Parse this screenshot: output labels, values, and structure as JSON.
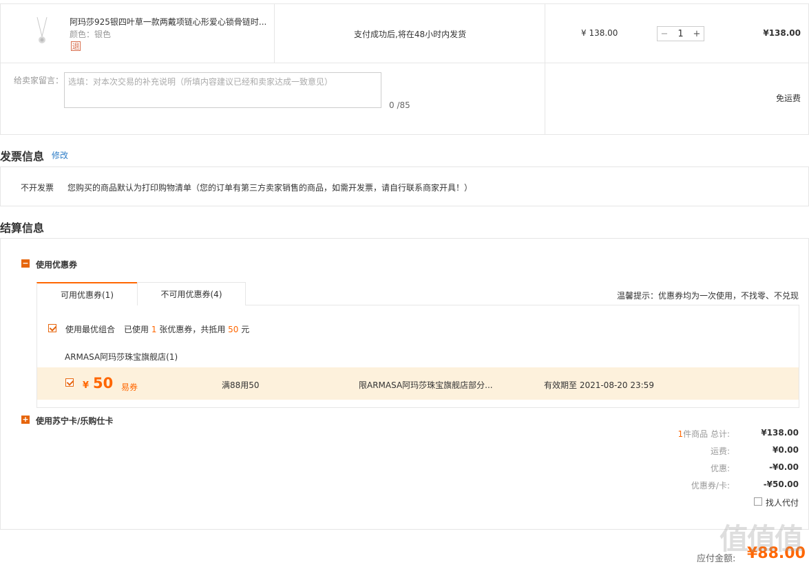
{
  "product": {
    "title": "阿玛莎925银四叶草一款两戴项链心形爱心锁骨链时...",
    "color_label": "颜色：银色",
    "badge": "退",
    "shipping_note": "支付成功后,将在48小时内发货",
    "unit_price": "¥ 138.00",
    "qty_minus": "−",
    "qty_value": "1",
    "qty_plus": "+",
    "subtotal": "¥138.00"
  },
  "remark": {
    "label": "给卖家留言：",
    "placeholder": "选填：对本次交易的补充说明（所填内容建议已经和卖家达成一致意见）",
    "counter": "0 /85",
    "shipping_fee": "免运费"
  },
  "invoice": {
    "title": "发票信息",
    "edit": "修改",
    "type": "不开发票",
    "note": "您购买的商品默认为打印购物清单（您的订单有第三方卖家销售的商品，如需开发票，请自行联系商家开具！）"
  },
  "settlement": {
    "title": "结算信息",
    "coupon_toggle_icon": "−",
    "coupon_section": "使用优惠券",
    "tabs": [
      {
        "label": "可用优惠券(1)"
      },
      {
        "label": "不可用优惠券(4)"
      }
    ],
    "tip": "温馨提示：优惠券均为一次使用，不找零、不兑现",
    "best_combo_label": "使用最优组合",
    "used_prefix": "已使用",
    "used_count": "1",
    "used_middle": "张优惠券，共抵用",
    "used_amount": "50",
    "used_suffix": "元",
    "store_name": "ARMASA阿玛莎珠宝旗舰店(1)",
    "coupon": {
      "currency": "¥",
      "amount": "50",
      "tag": "易券",
      "condition": "满88用50",
      "scope": "限ARMASA阿玛莎珠宝旗舰店部分...",
      "expiry": "有效期至 2021-08-20 23:59"
    },
    "card_toggle_icon": "+",
    "card_section": "使用苏宁卡/乐购仕卡"
  },
  "summary": {
    "count": "1",
    "count_label": "件商品 总计:",
    "total": "¥138.00",
    "freight_label": "运费:",
    "freight": "¥0.00",
    "discount_label": "优惠:",
    "discount": "-¥0.00",
    "coupon_label": "优惠券/卡:",
    "coupon_amount": "-¥50.00",
    "proxy_pay": "找人代付",
    "payable_label": "应付金额:",
    "payable": "¥88.00"
  },
  "watermark": "值值值",
  "colors": {
    "accent": "#ff6600",
    "coupon_bg": "#fdf1dc",
    "link": "#2e7dc7"
  }
}
